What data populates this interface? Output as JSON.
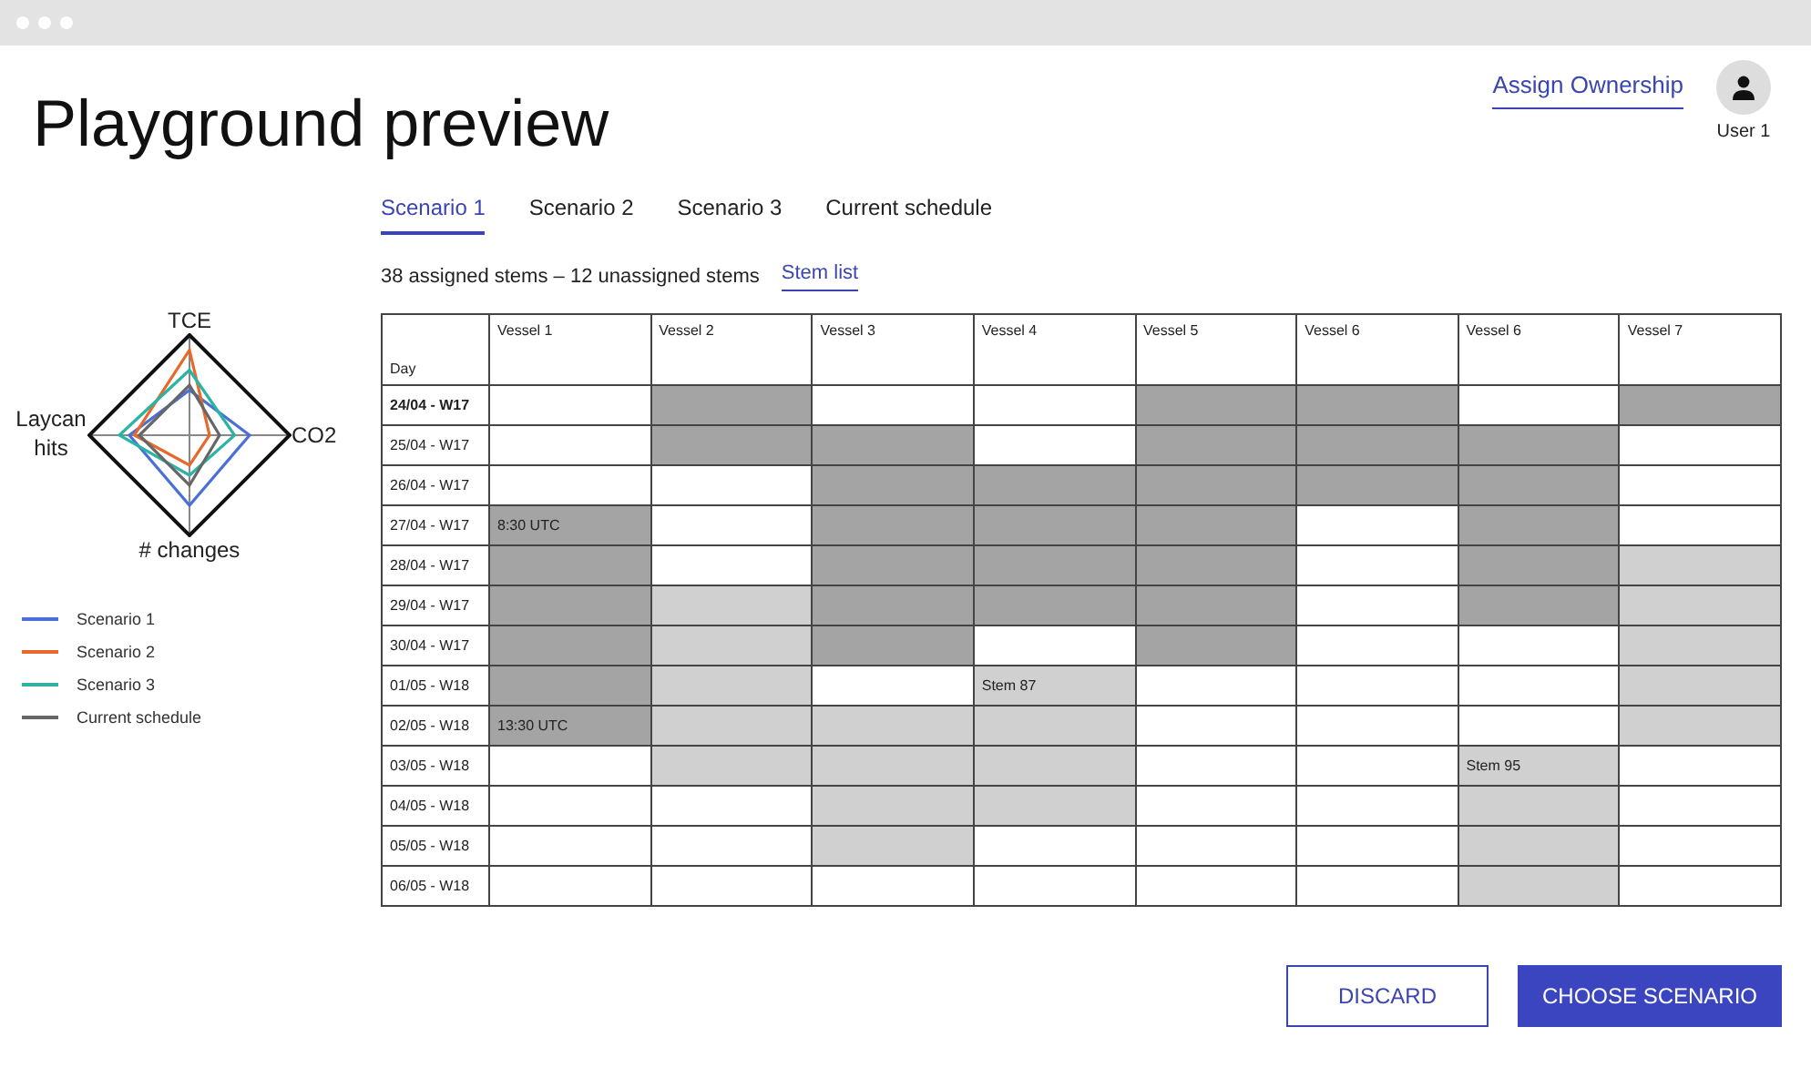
{
  "title": "Playground preview",
  "header": {
    "link": "Assign Ownership",
    "user": "User 1"
  },
  "tabs": [
    {
      "label": "Scenario 1",
      "selected": true
    },
    {
      "label": "Scenario 2",
      "selected": false
    },
    {
      "label": "Scenario 3",
      "selected": false
    },
    {
      "label": "Current schedule",
      "selected": false
    }
  ],
  "summary": {
    "text": "38 assigned stems – 12 unassigned stems",
    "link": "Stem list"
  },
  "radar": {
    "axes": [
      "TCE",
      "CO2",
      "# changes",
      "Laycan hits"
    ]
  },
  "legend": [
    {
      "label": "Scenario 1",
      "color": "#4a6fd8"
    },
    {
      "label": "Scenario 2",
      "color": "#e8672a"
    },
    {
      "label": "Scenario 3",
      "color": "#2bb3a3"
    },
    {
      "label": "Current schedule",
      "color": "#666666"
    }
  ],
  "table": {
    "columns": [
      "Day",
      "Vessel 1",
      "Vessel 2",
      "Vessel 3",
      "Vessel 4",
      "Vessel 5",
      "Vessel 6",
      "Vessel 6",
      "Vessel 7"
    ],
    "rows": [
      {
        "bold": true,
        "cells": [
          {
            "kind": "day",
            "text": "24/04 - W17"
          },
          {
            "kind": "blank"
          },
          {
            "kind": "dark"
          },
          {
            "kind": "blank"
          },
          {
            "kind": "blank"
          },
          {
            "kind": "dark"
          },
          {
            "kind": "dark"
          },
          {
            "kind": "blank"
          },
          {
            "kind": "dark"
          }
        ]
      },
      {
        "bold": false,
        "cells": [
          {
            "kind": "day",
            "text": "25/04 - W17"
          },
          {
            "kind": "blank"
          },
          {
            "kind": "dark"
          },
          {
            "kind": "dark"
          },
          {
            "kind": "blank"
          },
          {
            "kind": "dark"
          },
          {
            "kind": "dark"
          },
          {
            "kind": "dark"
          },
          {
            "kind": "blank"
          }
        ]
      },
      {
        "bold": false,
        "cells": [
          {
            "kind": "day",
            "text": "26/04 - W17"
          },
          {
            "kind": "blank"
          },
          {
            "kind": "blank"
          },
          {
            "kind": "dark"
          },
          {
            "kind": "dark"
          },
          {
            "kind": "dark"
          },
          {
            "kind": "dark"
          },
          {
            "kind": "dark"
          },
          {
            "kind": "blank"
          }
        ]
      },
      {
        "bold": false,
        "cells": [
          {
            "kind": "day",
            "text": "27/04 - W17"
          },
          {
            "kind": "dark",
            "text": "8:30 UTC"
          },
          {
            "kind": "blank"
          },
          {
            "kind": "dark"
          },
          {
            "kind": "dark"
          },
          {
            "kind": "dark"
          },
          {
            "kind": "blank"
          },
          {
            "kind": "dark"
          },
          {
            "kind": "blank"
          }
        ]
      },
      {
        "bold": false,
        "cells": [
          {
            "kind": "day",
            "text": "28/04 - W17"
          },
          {
            "kind": "dark"
          },
          {
            "kind": "blank"
          },
          {
            "kind": "dark"
          },
          {
            "kind": "dark"
          },
          {
            "kind": "dark"
          },
          {
            "kind": "blank"
          },
          {
            "kind": "dark"
          },
          {
            "kind": "light"
          }
        ]
      },
      {
        "bold": false,
        "cells": [
          {
            "kind": "day",
            "text": "29/04 - W17"
          },
          {
            "kind": "dark"
          },
          {
            "kind": "light"
          },
          {
            "kind": "dark"
          },
          {
            "kind": "dark"
          },
          {
            "kind": "dark"
          },
          {
            "kind": "blank"
          },
          {
            "kind": "dark"
          },
          {
            "kind": "light"
          }
        ]
      },
      {
        "bold": false,
        "cells": [
          {
            "kind": "day",
            "text": "30/04 - W17"
          },
          {
            "kind": "dark"
          },
          {
            "kind": "light"
          },
          {
            "kind": "dark"
          },
          {
            "kind": "blank"
          },
          {
            "kind": "dark"
          },
          {
            "kind": "blank"
          },
          {
            "kind": "blank"
          },
          {
            "kind": "light"
          }
        ]
      },
      {
        "bold": false,
        "cells": [
          {
            "kind": "day",
            "text": "01/05 - W18"
          },
          {
            "kind": "dark"
          },
          {
            "kind": "light"
          },
          {
            "kind": "blank"
          },
          {
            "kind": "light",
            "text": "Stem 87"
          },
          {
            "kind": "blank"
          },
          {
            "kind": "blank"
          },
          {
            "kind": "blank"
          },
          {
            "kind": "light"
          }
        ]
      },
      {
        "bold": false,
        "cells": [
          {
            "kind": "day",
            "text": "02/05 - W18"
          },
          {
            "kind": "dark",
            "text": "13:30 UTC"
          },
          {
            "kind": "light"
          },
          {
            "kind": "light"
          },
          {
            "kind": "light"
          },
          {
            "kind": "blank"
          },
          {
            "kind": "blank"
          },
          {
            "kind": "blank"
          },
          {
            "kind": "light"
          }
        ]
      },
      {
        "bold": false,
        "cells": [
          {
            "kind": "day",
            "text": "03/05 - W18"
          },
          {
            "kind": "blank"
          },
          {
            "kind": "light"
          },
          {
            "kind": "light"
          },
          {
            "kind": "light"
          },
          {
            "kind": "blank"
          },
          {
            "kind": "blank"
          },
          {
            "kind": "light",
            "text": "Stem 95"
          },
          {
            "kind": "blank"
          }
        ]
      },
      {
        "bold": false,
        "cells": [
          {
            "kind": "day",
            "text": "04/05 - W18"
          },
          {
            "kind": "blank"
          },
          {
            "kind": "blank"
          },
          {
            "kind": "light"
          },
          {
            "kind": "light"
          },
          {
            "kind": "blank"
          },
          {
            "kind": "blank"
          },
          {
            "kind": "light"
          },
          {
            "kind": "blank"
          }
        ]
      },
      {
        "bold": false,
        "cells": [
          {
            "kind": "day",
            "text": "05/05 - W18"
          },
          {
            "kind": "blank"
          },
          {
            "kind": "blank"
          },
          {
            "kind": "light"
          },
          {
            "kind": "blank"
          },
          {
            "kind": "blank"
          },
          {
            "kind": "blank"
          },
          {
            "kind": "light"
          },
          {
            "kind": "blank"
          }
        ]
      },
      {
        "bold": false,
        "cells": [
          {
            "kind": "day",
            "text": "06/05 - W18"
          },
          {
            "kind": "blank"
          },
          {
            "kind": "blank"
          },
          {
            "kind": "blank"
          },
          {
            "kind": "blank"
          },
          {
            "kind": "blank"
          },
          {
            "kind": "blank"
          },
          {
            "kind": "light"
          },
          {
            "kind": "blank"
          }
        ]
      }
    ]
  },
  "buttons": [
    {
      "label": "DISCARD",
      "kind": "secondary"
    },
    {
      "label": "CHOOSE SCENARIO",
      "kind": "primary"
    }
  ]
}
